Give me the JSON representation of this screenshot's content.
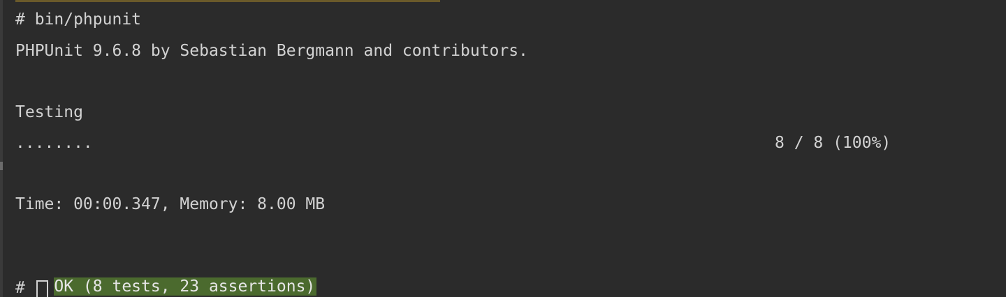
{
  "terminal": {
    "command_line": "# bin/phpunit",
    "version_line": "PHPUnit 9.6.8 by Sebastian Bergmann and contributors.",
    "testing_label": "Testing",
    "progress_dots": "........",
    "progress_count": "8 / 8 (100%)",
    "time_memory_line": "Time: 00:00.347, Memory: 8.00 MB",
    "result_line": "OK (8 tests, 23 assertions)",
    "prompt_symbol": "#"
  },
  "colors": {
    "background": "#2b2b2b",
    "text": "#d2d2d2",
    "ok_highlight": "#4b6a2e"
  }
}
